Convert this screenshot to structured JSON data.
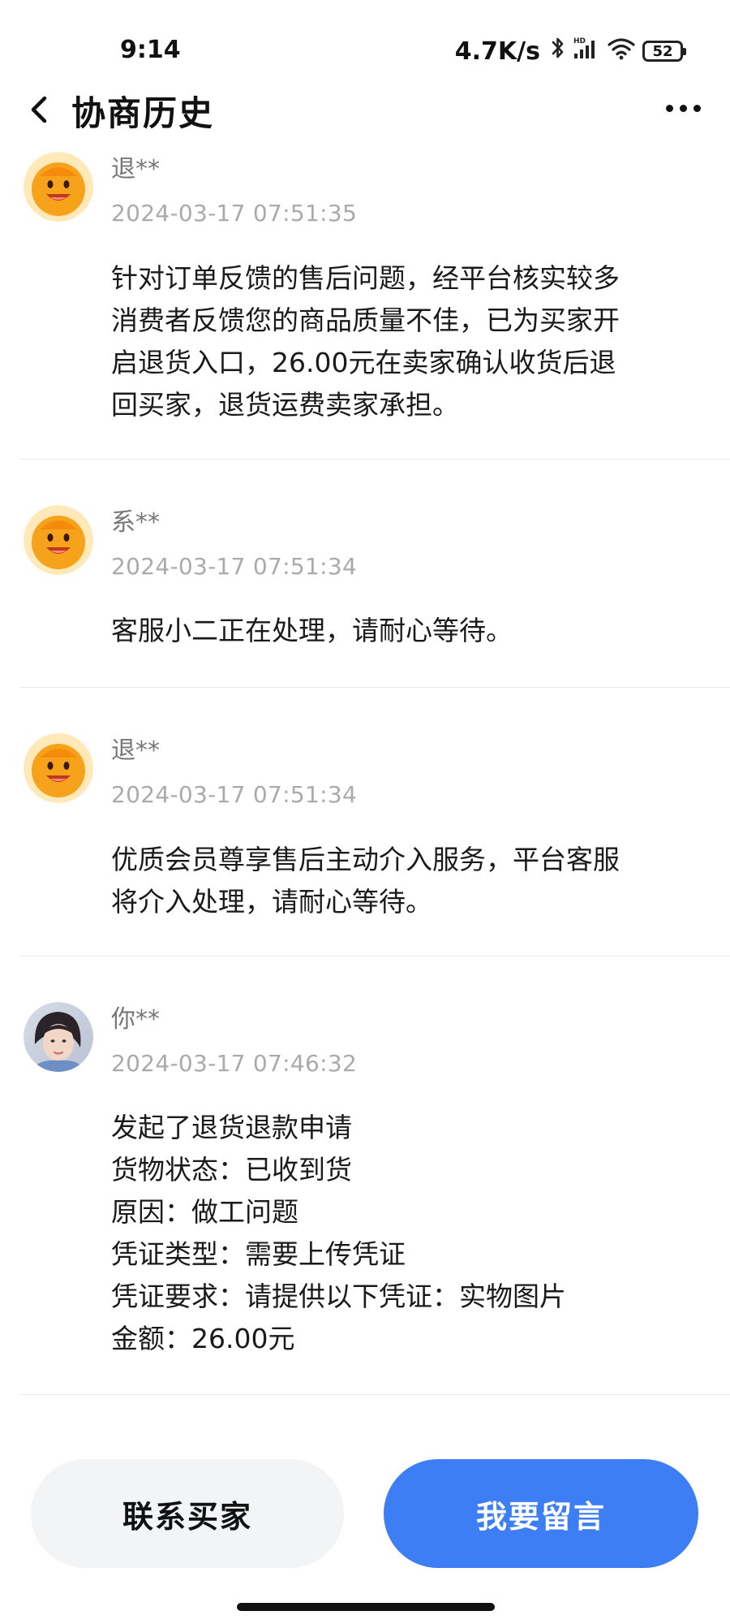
{
  "status_bar": {
    "time": "9:14",
    "net_speed": "4.7K/s",
    "icons": [
      "bluetooth-icon",
      "hd-signal-icon",
      "wifi-icon"
    ],
    "battery": "52"
  },
  "header": {
    "title": "协商历史",
    "back_icon": "chevron-left-icon",
    "more_icon": "more-horizontal-icon"
  },
  "entries": [
    {
      "avatar": "orange-mascot-avatar",
      "name": "退**",
      "timestamp": "2024-03-17 07:51:35",
      "lines": [
        "针对订单反馈的售后问题，经平台核实较多",
        "消费者反馈您的商品质量不佳，已为买家开",
        "启退货入口，26.00元在卖家确认收货后退",
        "回买家，退货运费卖家承担。"
      ]
    },
    {
      "avatar": "orange-mascot-avatar",
      "name": "系**",
      "timestamp": "2024-03-17 07:51:34",
      "lines": [
        "客服小二正在处理，请耐心等待。"
      ]
    },
    {
      "avatar": "orange-mascot-avatar",
      "name": "退**",
      "timestamp": "2024-03-17 07:51:34",
      "lines": [
        "优质会员尊享售后主动介入服务，平台客服",
        "将介入处理，请耐心等待。"
      ]
    },
    {
      "avatar": "user-photo-avatar",
      "name": "你**",
      "timestamp": "2024-03-17 07:46:32",
      "lines": [
        "发起了退货退款申请",
        "货物状态：已收到货",
        "原因：做工问题",
        "凭证类型：需要上传凭证",
        "凭证要求：请提供以下凭证：实物图片",
        "金额：26.00元"
      ]
    }
  ],
  "buttons": {
    "contact_buyer": "联系买家",
    "leave_message": "我要留言"
  },
  "colors": {
    "primary": "#3d7ef5",
    "secondary_button_bg": "#f3f4f6",
    "mascot_orange": "#f7a21b"
  }
}
